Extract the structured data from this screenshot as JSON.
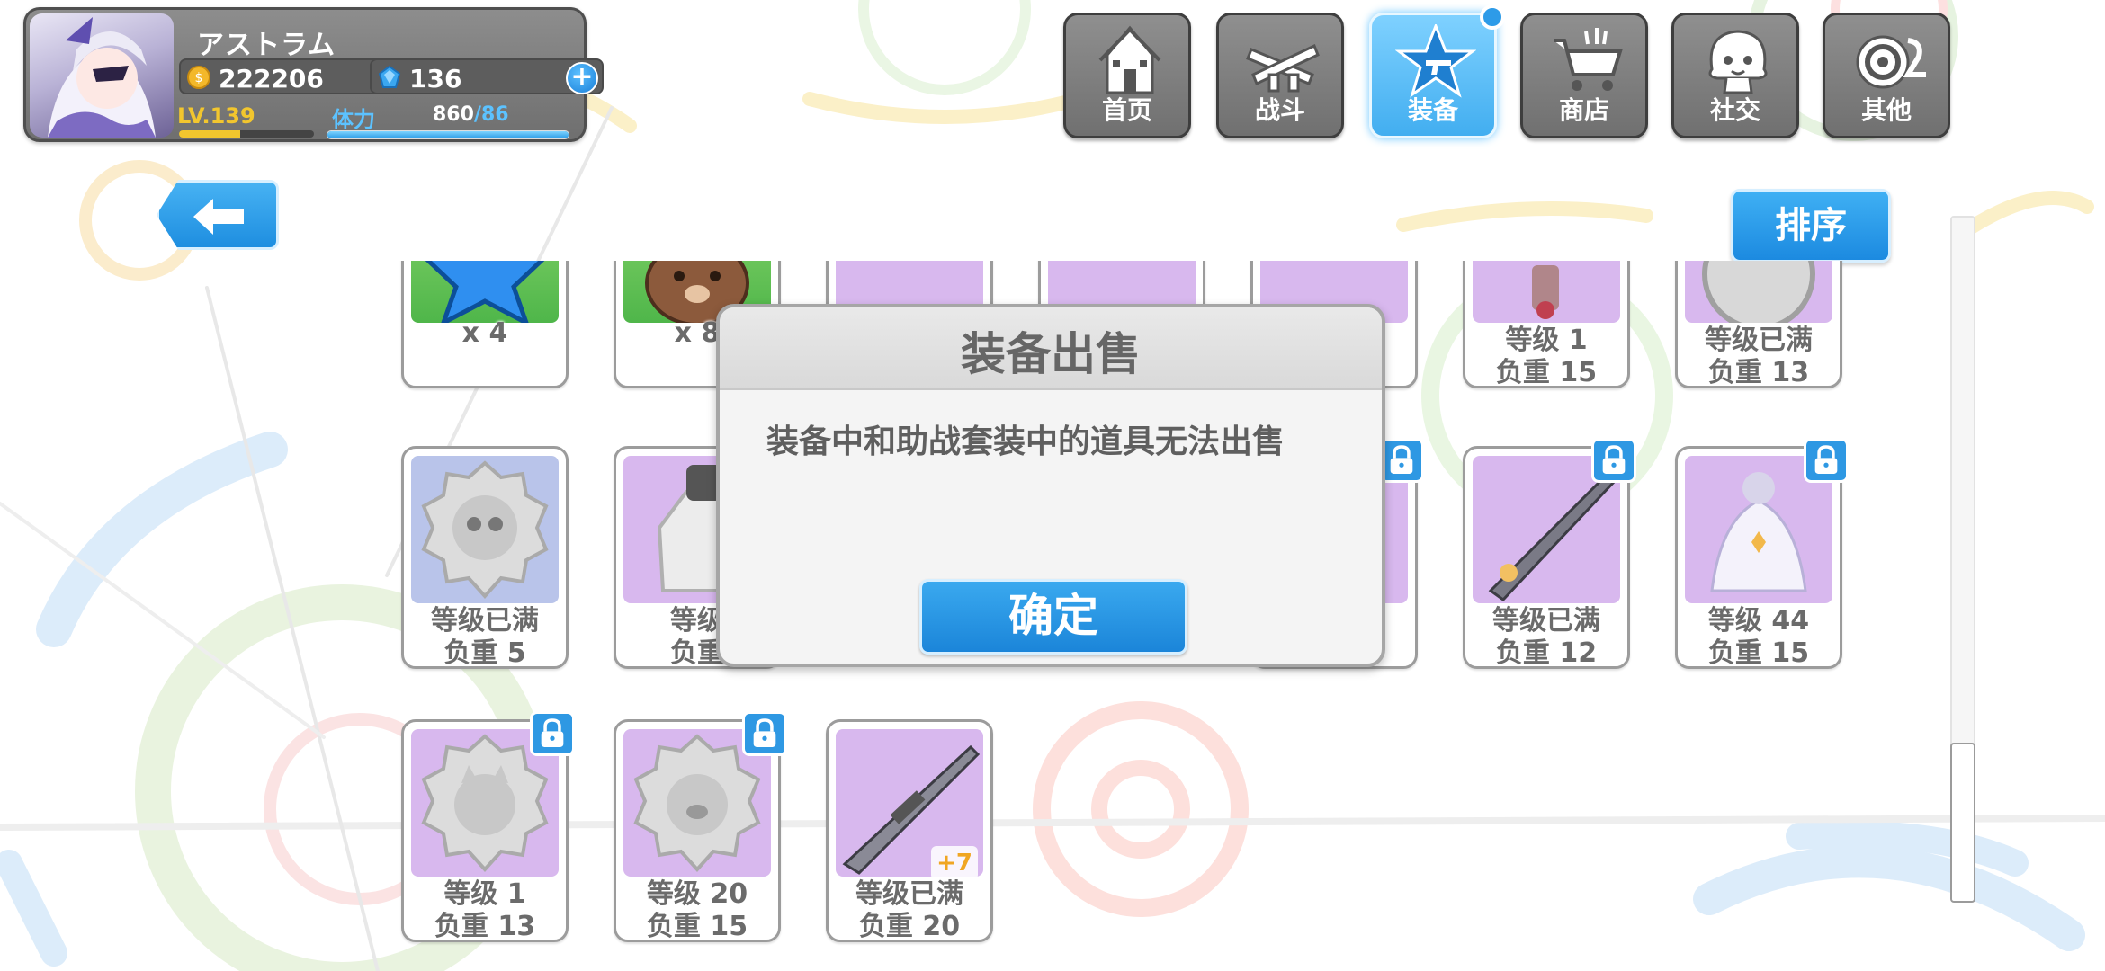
{
  "player": {
    "name": "アストラム",
    "gold": "222206",
    "gems": "136",
    "level": "LV.139",
    "stamina_label": "体力",
    "stamina_current": "860",
    "stamina_max": "/86",
    "level_progress": 0.45,
    "stamina_progress": 1.0
  },
  "nav": {
    "items": [
      {
        "label": "首页",
        "icon": "house-icon"
      },
      {
        "label": "战斗",
        "icon": "crossed-guns-icon"
      },
      {
        "label": "装备",
        "icon": "star-gun-icon",
        "active": true
      },
      {
        "label": "商店",
        "icon": "cart-icon"
      },
      {
        "label": "社交",
        "icon": "character-face-icon"
      },
      {
        "label": "其他",
        "icon": "target-icon"
      }
    ]
  },
  "sort_label": "排序",
  "inventory": {
    "row1": [
      {
        "line1": "x 4",
        "art": "blue-star"
      },
      {
        "line1": "x 8",
        "art": "bear-head"
      },
      {
        "line1": "",
        "line2": "",
        "art": "purple"
      },
      {
        "line1": "",
        "line2": "",
        "art": "purple"
      },
      {
        "line1": "",
        "line2": "",
        "art": "purple"
      },
      {
        "line1": "等级 1",
        "line2": "负重 15",
        "art": "purple"
      },
      {
        "line1": "等级已满",
        "line2": "负重 13",
        "art": "badge"
      }
    ],
    "row2": [
      {
        "line1": "等级已满",
        "line2": "负重 5",
        "art": "skull-badge",
        "locked": false
      },
      {
        "line1": "等级",
        "line2": "负重",
        "art": "armor",
        "locked": false
      },
      {
        "line1": "",
        "line2": "",
        "art": "purple",
        "locked": true
      },
      {
        "line1": "等级已满",
        "line2": "负重 12",
        "art": "rifle",
        "locked": true
      },
      {
        "line1": "等级 44",
        "line2": "负重 15",
        "art": "outfit",
        "locked": true
      }
    ],
    "row3": [
      {
        "line1": "等级 1",
        "line2": "负重 13",
        "art": "cat-badge",
        "locked": true
      },
      {
        "line1": "等级 20",
        "line2": "负重 15",
        "art": "pig-badge",
        "locked": true
      },
      {
        "line1": "等级已满",
        "line2": "负重 20",
        "art": "sniper",
        "locked": false,
        "plus": "+7"
      }
    ]
  },
  "dialog": {
    "title": "装备出售",
    "message": "装备中和助战套装中的道具无法出售",
    "confirm": "确定"
  },
  "colors": {
    "accent": "#2e98e3",
    "gold": "#f2c62e",
    "card_purple": "#d8b8ee"
  }
}
